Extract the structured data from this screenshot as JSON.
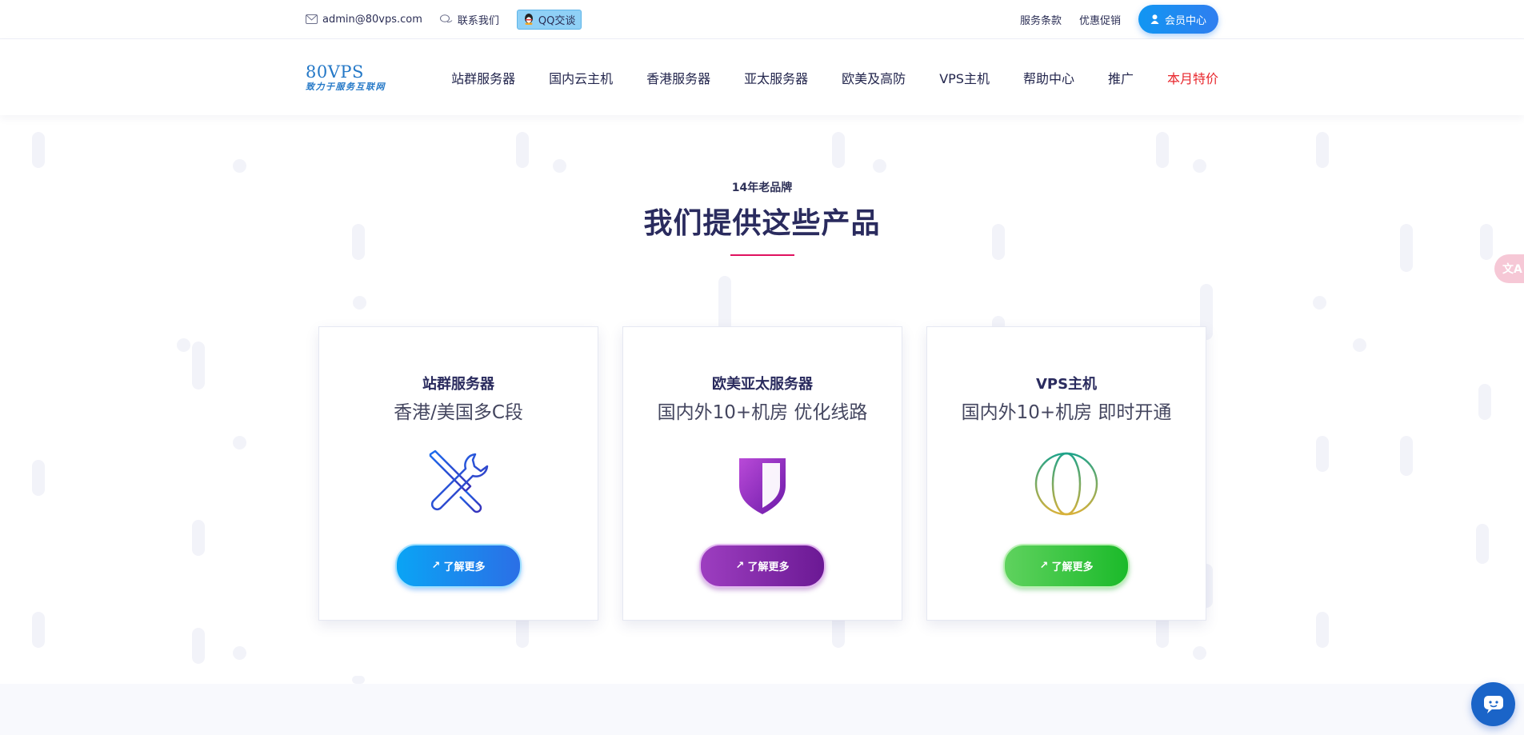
{
  "topbar": {
    "email": "admin@80vps.com",
    "contact": "联系我们",
    "qq": "QQ交谈",
    "terms": "服务条款",
    "promo": "优惠促销",
    "member": "会员中心"
  },
  "logo": {
    "main": "80VPS",
    "sub": "致力于服务互联网"
  },
  "nav": {
    "items": [
      "站群服务器",
      "国内云主机",
      "香港服务器",
      "亚太服务器",
      "欧美及高防",
      "VPS主机",
      "帮助中心",
      "推广",
      "本月特价"
    ]
  },
  "section": {
    "subtitle": "14年老品牌",
    "title": "我们提供这些产品"
  },
  "cards": [
    {
      "title": "站群服务器",
      "subtitle": "香港/美国多C段",
      "icon": "tools-icon",
      "button": "了解更多",
      "color": "#2b6fe6"
    },
    {
      "title": "欧美亚太服务器",
      "subtitle": "国内外10+机房 优化线路",
      "icon": "shield-icon",
      "button": "了解更多",
      "color": "#8a2ab0"
    },
    {
      "title": "VPS主机",
      "subtitle": "国内外10+机房 即时开通",
      "icon": "globe-icon",
      "button": "了解更多",
      "color": "#22bb33"
    }
  ],
  "floating": {
    "translate": "文A"
  }
}
